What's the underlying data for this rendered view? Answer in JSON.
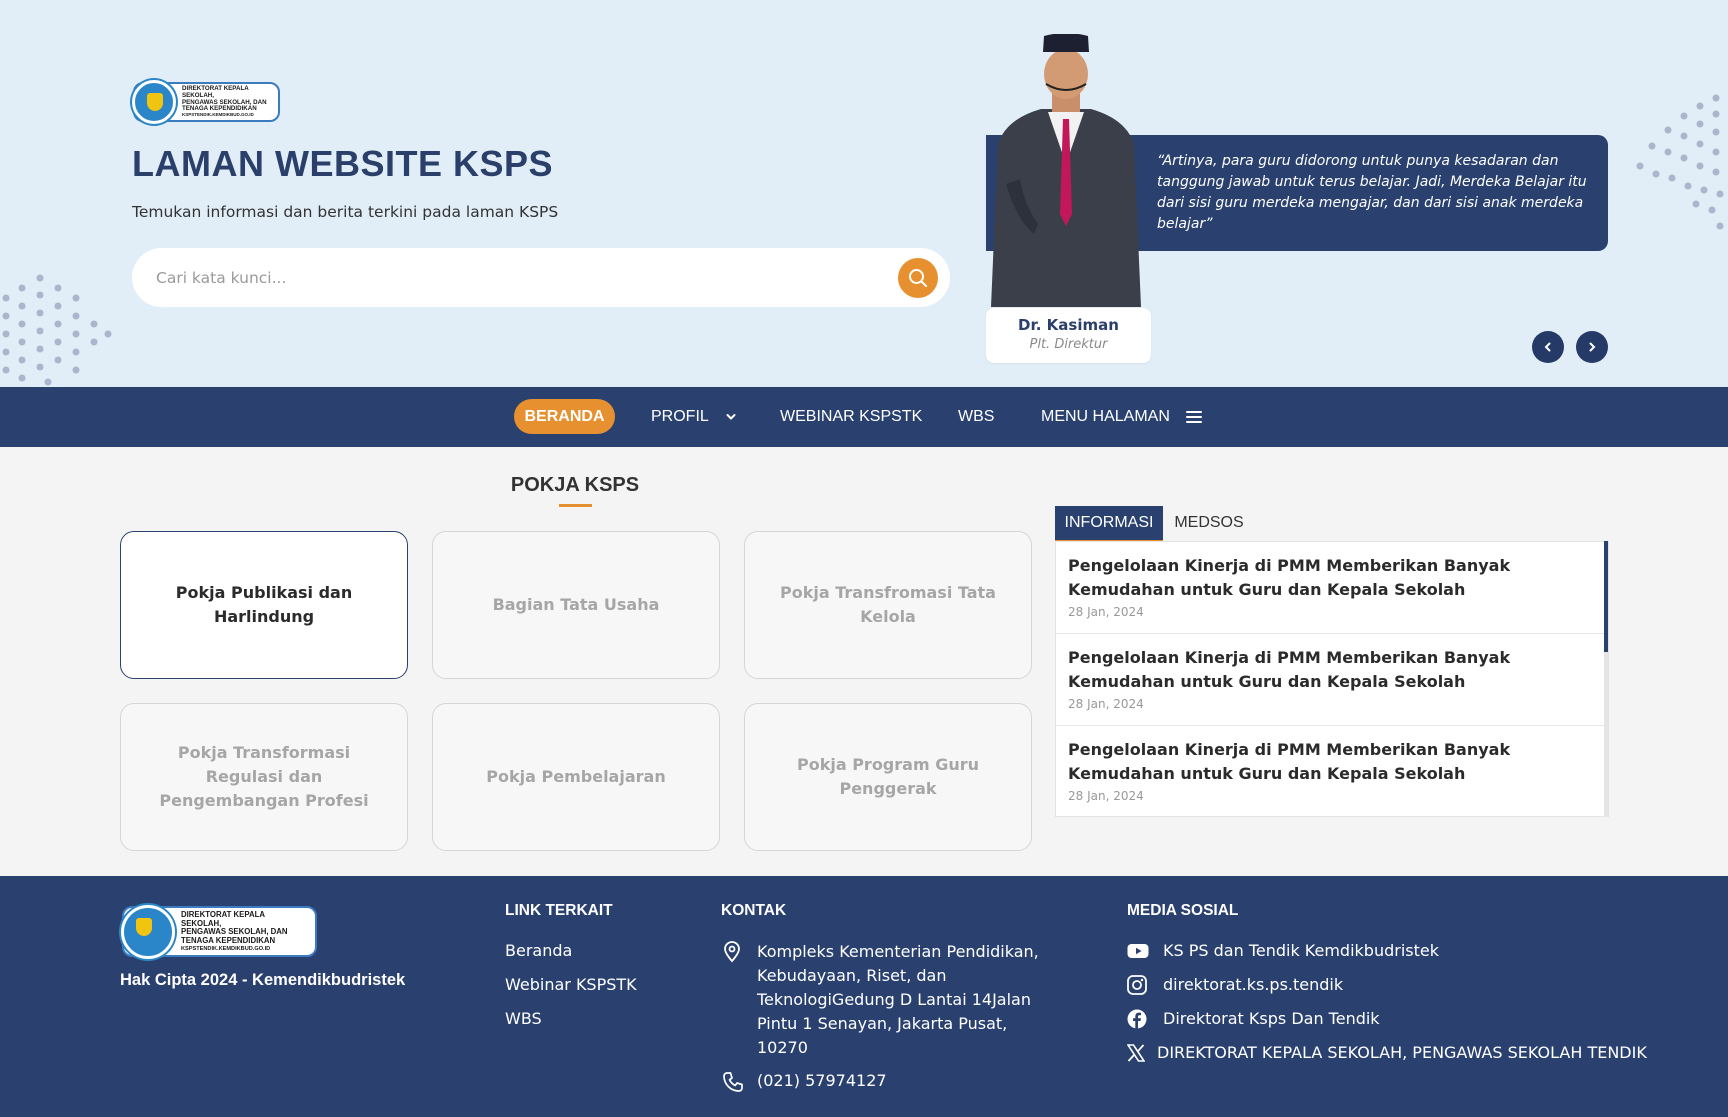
{
  "hero": {
    "logo_text": [
      "DIREKTORAT KEPALA SEKOLAH,",
      "PENGAWAS SEKOLAH, DAN",
      "TENAGA KEPENDIDIKAN",
      "KSPSTENDIK.KEMDIKBUD.GO.ID"
    ],
    "title": "LAMAN WEBSITE KSPS",
    "subtitle": "Temukan informasi dan berita terkini pada laman KSPS",
    "search_placeholder": "Cari kata kunci...",
    "quote": "“Artinya, para guru didorong untuk punya kesadaran dan tanggung jawab untuk terus belajar. Jadi, Merdeka Belajar itu dari sisi guru merdeka mengajar, dan dari sisi anak merdeka belajar”",
    "person_name": "Dr. Kasiman",
    "person_role": "Plt. Direktur",
    "prev_icon": "‹",
    "next_icon": "›"
  },
  "nav": {
    "beranda": "BERANDA",
    "profil": "PROFIL",
    "webinar": "WEBINAR KSPSTK",
    "wbs": "WBS",
    "menu": "MENU HALAMAN"
  },
  "pokja": {
    "title": "POKJA KSPS",
    "cards": [
      "Pokja Publikasi dan Harlindung",
      "Bagian Tata Usaha",
      "Pokja Transfromasi Tata Kelola",
      "Pokja Transformasi Regulasi dan Pengembangan Profesi",
      "Pokja Pembelajaran",
      "Pokja Program Guru Penggerak"
    ]
  },
  "info": {
    "tabs": [
      "INFORMASI",
      "MEDSOS"
    ],
    "news": [
      {
        "title": "Pengelolaan Kinerja di PMM Memberikan Banyak Kemudahan untuk Guru dan Kepala Sekolah",
        "date": "28 Jan, 2024"
      },
      {
        "title": "Pengelolaan Kinerja di PMM Memberikan Banyak Kemudahan untuk Guru dan Kepala Sekolah",
        "date": "28 Jan, 2024"
      },
      {
        "title": "Pengelolaan Kinerja di PMM Memberikan Banyak Kemudahan untuk Guru dan Kepala Sekolah",
        "date": "28 Jan, 2024"
      }
    ]
  },
  "footer": {
    "logo_text": [
      "DIREKTORAT KEPALA SEKOLAH,",
      "PENGAWAS SEKOLAH, DAN",
      "TENAGA KEPENDIDIKAN",
      "KSPSTENDIK.KEMDIKBUD.GO.ID"
    ],
    "copyright": "Hak Cipta 2024 - Kemendikbudristek",
    "links_heading": "LINK TERKAIT",
    "links": [
      "Beranda",
      "Webinar KSPSTK",
      "WBS"
    ],
    "contact_heading": "KONTAK",
    "address": "Kompleks Kementerian Pendidikan, Kebudayaan, Riset, dan TeknologiGedung D Lantai 14Jalan Pintu 1 Senayan, Jakarta Pusat, 10270",
    "phone": "(021) 57974127",
    "social_heading": "MEDIA SOSIAL",
    "social": [
      {
        "icon": "youtube-icon",
        "label": "KS PS dan Tendik Kemdikbudristek"
      },
      {
        "icon": "instagram-icon",
        "label": "direktorat.ks.ps.tendik"
      },
      {
        "icon": "facebook-icon",
        "label": "Direktorat Ksps Dan Tendik"
      },
      {
        "icon": "x-twitter-icon",
        "label": "DIREKTORAT KEPALA SEKOLAH, PENGAWAS SEKOLAH TENDIK"
      }
    ]
  },
  "colors": {
    "navy": "#2a4170",
    "orange": "#e7902f",
    "hero_bg": "#e1eef8"
  }
}
